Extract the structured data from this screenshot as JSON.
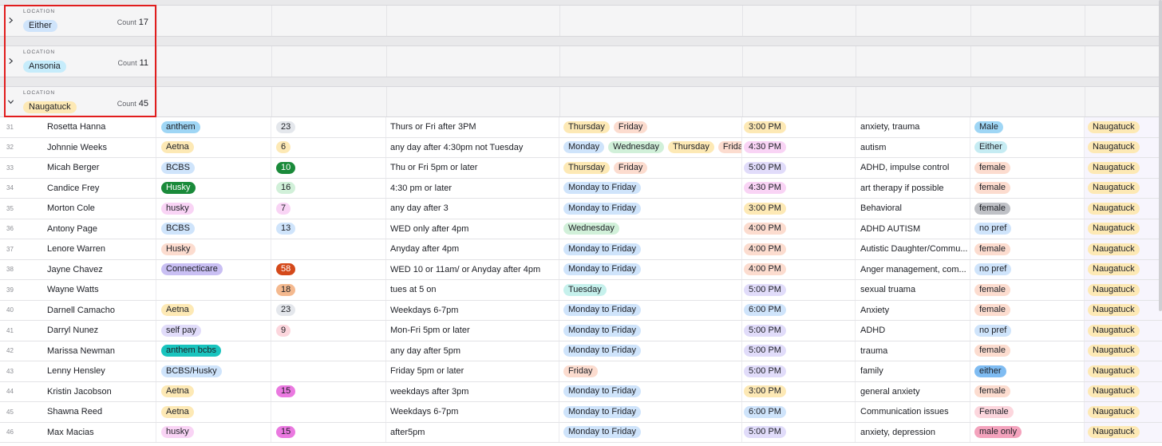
{
  "groups": [
    {
      "label": "LOCATION",
      "value": "Either",
      "color": "#cfe4fb",
      "count_label": "Count",
      "count": "17",
      "expanded": false
    },
    {
      "label": "LOCATION",
      "value": "Ansonia",
      "color": "#c6ecfb",
      "count_label": "Count",
      "count": "11",
      "expanded": false
    },
    {
      "label": "LOCATION",
      "value": "Naugatuck",
      "color": "#fde9b5",
      "count_label": "Count",
      "count": "45",
      "expanded": true
    }
  ],
  "icons": {
    "collapsed": "chevron-right-icon",
    "expanded": "chevron-down-icon"
  },
  "colors": {
    "highlight": "#e11d1d",
    "location_pill": "#fde9b5"
  },
  "rows": [
    {
      "num": "31",
      "name": "Rosetta Hanna",
      "insurance": {
        "text": "anthem",
        "color": "#9fd6f5"
      },
      "count": {
        "text": "23",
        "color": "#e4e7ec"
      },
      "availability": "Thurs or Fri after 3PM",
      "days": [
        {
          "text": "Thursday",
          "color": "#fde9b5"
        },
        {
          "text": "Friday",
          "color": "#fcdccf"
        }
      ],
      "time": {
        "text": "3:00 PM",
        "color": "#fde9b5"
      },
      "issue": "anxiety, trauma",
      "pref": {
        "text": "Male",
        "color": "#9fd6f5"
      },
      "location": "Naugatuck"
    },
    {
      "num": "32",
      "name": "Johnnie Weeks",
      "insurance": {
        "text": "Aetna",
        "color": "#fde9b5"
      },
      "count": {
        "text": "6",
        "color": "#fde9b5"
      },
      "availability": "any day after 4:30pm not Tuesday",
      "days": [
        {
          "text": "Monday",
          "color": "#cfe4fb"
        },
        {
          "text": "Wednesday",
          "color": "#d1f0d9"
        },
        {
          "text": "Thursday",
          "color": "#fde9b5"
        },
        {
          "text": "Friday",
          "color": "#fcdccf"
        }
      ],
      "time": {
        "text": "4:30 PM",
        "color": "#f9d4f5"
      },
      "issue": "autism",
      "pref": {
        "text": "Either",
        "color": "#c6ecf3"
      },
      "location": "Naugatuck"
    },
    {
      "num": "33",
      "name": "Micah Berger",
      "insurance": {
        "text": "BCBS",
        "color": "#cfe4fb"
      },
      "count": {
        "text": "10",
        "color": "#1a8a3a",
        "dark": true
      },
      "availability": "Thu or Fri 5pm or later",
      "days": [
        {
          "text": "Thursday",
          "color": "#fde9b5"
        },
        {
          "text": "Friday",
          "color": "#fcdccf"
        }
      ],
      "time": {
        "text": "5:00 PM",
        "color": "#e1dcfa"
      },
      "issue": "ADHD, impulse control",
      "pref": {
        "text": "female",
        "color": "#fcdccf"
      },
      "location": "Naugatuck"
    },
    {
      "num": "34",
      "name": "Candice Frey",
      "insurance": {
        "text": "Husky",
        "color": "#1a8a3a",
        "dark": true
      },
      "count": {
        "text": "16",
        "color": "#d1f0d9"
      },
      "availability": "4:30 pm or later",
      "days": [
        {
          "text": "Monday to Friday",
          "color": "#cfe4fb"
        }
      ],
      "time": {
        "text": "4:30 PM",
        "color": "#f9d4f5"
      },
      "issue": "art therapy if possible",
      "pref": {
        "text": "female",
        "color": "#fcdccf"
      },
      "location": "Naugatuck"
    },
    {
      "num": "35",
      "name": "Morton Cole",
      "insurance": {
        "text": "husky",
        "color": "#f9d4f5"
      },
      "count": {
        "text": "7",
        "color": "#f9d4f5"
      },
      "availability": "any day after 3",
      "days": [
        {
          "text": "Monday to Friday",
          "color": "#cfe4fb"
        }
      ],
      "time": {
        "text": "3:00 PM",
        "color": "#fde9b5"
      },
      "issue": "Behavioral",
      "pref": {
        "text": "female",
        "color": "#bfc1c6"
      },
      "location": "Naugatuck"
    },
    {
      "num": "36",
      "name": "Antony Page",
      "insurance": {
        "text": "BCBS",
        "color": "#cfe4fb"
      },
      "count": {
        "text": "13",
        "color": "#cfe4fb"
      },
      "availability": "WED only after 4pm",
      "days": [
        {
          "text": "Wednesday",
          "color": "#d1f0d9"
        }
      ],
      "time": {
        "text": "4:00 PM",
        "color": "#fcdccf"
      },
      "issue": "ADHD AUTISM",
      "pref": {
        "text": "no pref",
        "color": "#cfe4fb"
      },
      "location": "Naugatuck"
    },
    {
      "num": "37",
      "name": "Lenore Warren",
      "insurance": {
        "text": "Husky",
        "color": "#fcdccf"
      },
      "count": null,
      "availability": "Anyday after 4pm",
      "days": [
        {
          "text": "Monday to Friday",
          "color": "#cfe4fb"
        }
      ],
      "time": {
        "text": "4:00 PM",
        "color": "#fcdccf"
      },
      "issue": "Autistic Daughter/Commu...",
      "pref": {
        "text": "female",
        "color": "#fcdccf"
      },
      "location": "Naugatuck"
    },
    {
      "num": "38",
      "name": "Jayne Chavez",
      "insurance": {
        "text": "Connecticare",
        "color": "#c9bff3"
      },
      "count": {
        "text": "58",
        "color": "#d4491a",
        "dark": true
      },
      "availability": "WED 10 or 11am/ or Anyday after 4pm",
      "days": [
        {
          "text": "Monday to Friday",
          "color": "#cfe4fb"
        }
      ],
      "time": {
        "text": "4:00 PM",
        "color": "#fcdccf"
      },
      "issue": "Anger management, com...",
      "pref": {
        "text": "no pref",
        "color": "#cfe4fb"
      },
      "location": "Naugatuck"
    },
    {
      "num": "39",
      "name": "Wayne Watts",
      "insurance": null,
      "count": {
        "text": "18",
        "color": "#f4b98f"
      },
      "availability": "tues at 5 on",
      "days": [
        {
          "text": "Tuesday",
          "color": "#c6f1ec"
        }
      ],
      "time": {
        "text": "5:00 PM",
        "color": "#e1dcfa"
      },
      "issue": "sexual truama",
      "pref": {
        "text": "female",
        "color": "#fcdccf"
      },
      "location": "Naugatuck"
    },
    {
      "num": "40",
      "name": "Darnell Camacho",
      "insurance": {
        "text": "Aetna",
        "color": "#fde9b5"
      },
      "count": {
        "text": "23",
        "color": "#e4e7ec"
      },
      "availability": "Weekdays 6-7pm",
      "days": [
        {
          "text": "Monday to Friday",
          "color": "#cfe4fb"
        }
      ],
      "time": {
        "text": "6:00 PM",
        "color": "#cfe4fb"
      },
      "issue": "Anxiety",
      "pref": {
        "text": "female",
        "color": "#fcdccf"
      },
      "location": "Naugatuck"
    },
    {
      "num": "41",
      "name": "Darryl Nunez",
      "insurance": {
        "text": "self pay",
        "color": "#e1dcfa"
      },
      "count": {
        "text": "9",
        "color": "#fcd6dd"
      },
      "availability": "Mon-Fri 5pm or later",
      "days": [
        {
          "text": "Monday to Friday",
          "color": "#cfe4fb"
        }
      ],
      "time": {
        "text": "5:00 PM",
        "color": "#e1dcfa"
      },
      "issue": "ADHD",
      "pref": {
        "text": "no pref",
        "color": "#cfe4fb"
      },
      "location": "Naugatuck"
    },
    {
      "num": "42",
      "name": "Marissa Newman",
      "insurance": {
        "text": "anthem bcbs",
        "color": "#19c4be"
      },
      "count": null,
      "availability": "any day after 5pm",
      "days": [
        {
          "text": "Monday to Friday",
          "color": "#cfe4fb"
        }
      ],
      "time": {
        "text": "5:00 PM",
        "color": "#e1dcfa"
      },
      "issue": "trauma",
      "pref": {
        "text": "female",
        "color": "#fcdccf"
      },
      "location": "Naugatuck"
    },
    {
      "num": "43",
      "name": "Lenny Hensley",
      "insurance": {
        "text": "BCBS/Husky",
        "color": "#cfe4fb"
      },
      "count": null,
      "availability": "Friday 5pm or later",
      "days": [
        {
          "text": "Friday",
          "color": "#fcdccf"
        }
      ],
      "time": {
        "text": "5:00 PM",
        "color": "#e1dcfa"
      },
      "issue": "family",
      "pref": {
        "text": "either",
        "color": "#7fbcf2"
      },
      "location": "Naugatuck"
    },
    {
      "num": "44",
      "name": "Kristin Jacobson",
      "insurance": {
        "text": "Aetna",
        "color": "#fde9b5"
      },
      "count": {
        "text": "15",
        "color": "#ea79e0"
      },
      "availability": "weekdays after 3pm",
      "days": [
        {
          "text": "Monday to Friday",
          "color": "#cfe4fb"
        }
      ],
      "time": {
        "text": "3:00 PM",
        "color": "#fde9b5"
      },
      "issue": "general anxiety",
      "pref": {
        "text": "female",
        "color": "#fcdccf"
      },
      "location": "Naugatuck"
    },
    {
      "num": "45",
      "name": "Shawna Reed",
      "insurance": {
        "text": "Aetna",
        "color": "#fde9b5"
      },
      "count": null,
      "availability": "Weekdays 6-7pm",
      "days": [
        {
          "text": "Monday to Friday",
          "color": "#cfe4fb"
        }
      ],
      "time": {
        "text": "6:00 PM",
        "color": "#cfe4fb"
      },
      "issue": "Communication issues",
      "pref": {
        "text": "Female",
        "color": "#fcd6dd"
      },
      "location": "Naugatuck"
    },
    {
      "num": "46",
      "name": "Max Macias",
      "insurance": {
        "text": "husky",
        "color": "#f9d4f5"
      },
      "count": {
        "text": "15",
        "color": "#ea79e0"
      },
      "availability": "after5pm",
      "days": [
        {
          "text": "Monday to Friday",
          "color": "#cfe4fb"
        }
      ],
      "time": {
        "text": "5:00 PM",
        "color": "#e1dcfa"
      },
      "issue": "anxiety, depression",
      "pref": {
        "text": "male only",
        "color": "#f4a3bd"
      },
      "location": "Naugatuck"
    }
  ]
}
